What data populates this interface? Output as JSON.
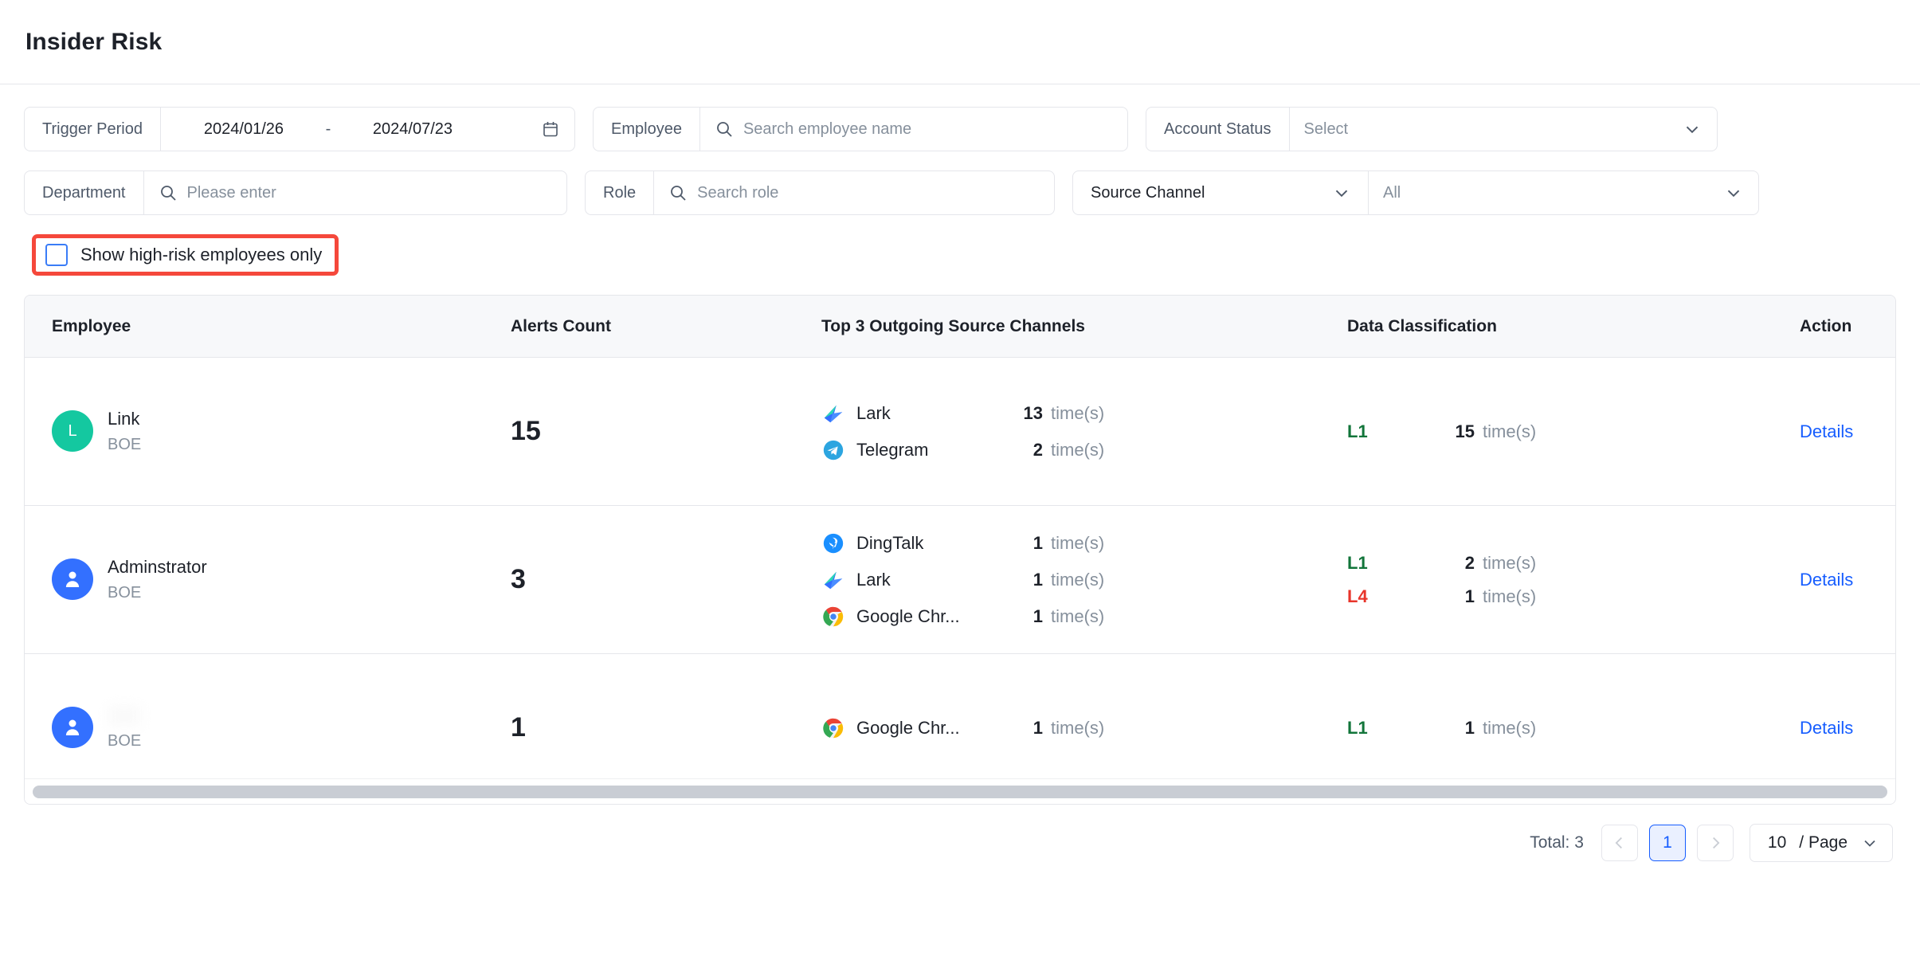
{
  "header": {
    "title": "Insider Risk"
  },
  "filters": {
    "trigger_period": {
      "label": "Trigger Period",
      "start": "2024/01/26",
      "separator": "-",
      "end": "2024/07/23",
      "icon": "calendar-icon"
    },
    "employee": {
      "label": "Employee",
      "placeholder": "Search employee name",
      "value": "",
      "icon": "search-icon"
    },
    "account_status": {
      "label": "Account Status",
      "placeholder": "Select",
      "value": "",
      "icon": "chevron-down-icon"
    },
    "department": {
      "label": "Department",
      "placeholder": "Please enter",
      "value": "",
      "icon": "search-icon"
    },
    "role": {
      "label": "Role",
      "placeholder": "Search role",
      "value": "",
      "icon": "search-icon"
    },
    "source_channel": {
      "label": "Source Channel",
      "value": "All",
      "icon": "chevron-down-icon"
    },
    "high_risk_toggle": {
      "label": "Show high-risk employees only",
      "checked": false,
      "highlight_color": "#f5483b"
    }
  },
  "table": {
    "columns": [
      "Employee",
      "Alerts Count",
      "Top 3 Outgoing Source Channels",
      "Data Classification",
      "Action"
    ],
    "unit_label": "time(s)",
    "action_label": "Details",
    "rows": [
      {
        "employee": {
          "name": "Link",
          "department": "BOE",
          "avatar_letter": "L",
          "avatar_type": "letter",
          "avatar_color": "#14c8a0"
        },
        "alerts_count": "15",
        "channels": [
          {
            "name": "Lark",
            "icon": "lark-icon",
            "count": "13"
          },
          {
            "name": "Telegram",
            "icon": "telegram-icon",
            "count": "2"
          }
        ],
        "classifications": [
          {
            "level": "L1",
            "count": "15",
            "color": "#12753a"
          }
        ]
      },
      {
        "employee": {
          "name": "Adminstrator",
          "department": "BOE",
          "avatar_letter": "",
          "avatar_type": "person",
          "avatar_color": "#3370ff"
        },
        "alerts_count": "3",
        "channels": [
          {
            "name": "DingTalk",
            "icon": "dingtalk-icon",
            "count": "1"
          },
          {
            "name": "Lark",
            "icon": "lark-icon",
            "count": "1"
          },
          {
            "name": "Google Chr...",
            "icon": "chrome-icon",
            "count": "1"
          }
        ],
        "classifications": [
          {
            "level": "L1",
            "count": "2",
            "color": "#12753a"
          },
          {
            "level": "L4",
            "count": "1",
            "color": "#e8352b"
          }
        ]
      },
      {
        "employee": {
          "name": "",
          "department": "BOE",
          "avatar_letter": "",
          "avatar_type": "person",
          "avatar_color": "#3370ff",
          "redacted": true
        },
        "alerts_count": "1",
        "channels": [
          {
            "name": "Google Chr...",
            "icon": "chrome-icon",
            "count": "1"
          }
        ],
        "classifications": [
          {
            "level": "L1",
            "count": "1",
            "color": "#12753a"
          }
        ]
      }
    ]
  },
  "pagination": {
    "total": "Total: 3",
    "prev_icon": "chevron-left-icon",
    "next_icon": "chevron-right-icon",
    "current_page": "1",
    "page_size": "10",
    "page_size_unit": "/ Page",
    "page_size_icon": "chevron-down-icon"
  }
}
